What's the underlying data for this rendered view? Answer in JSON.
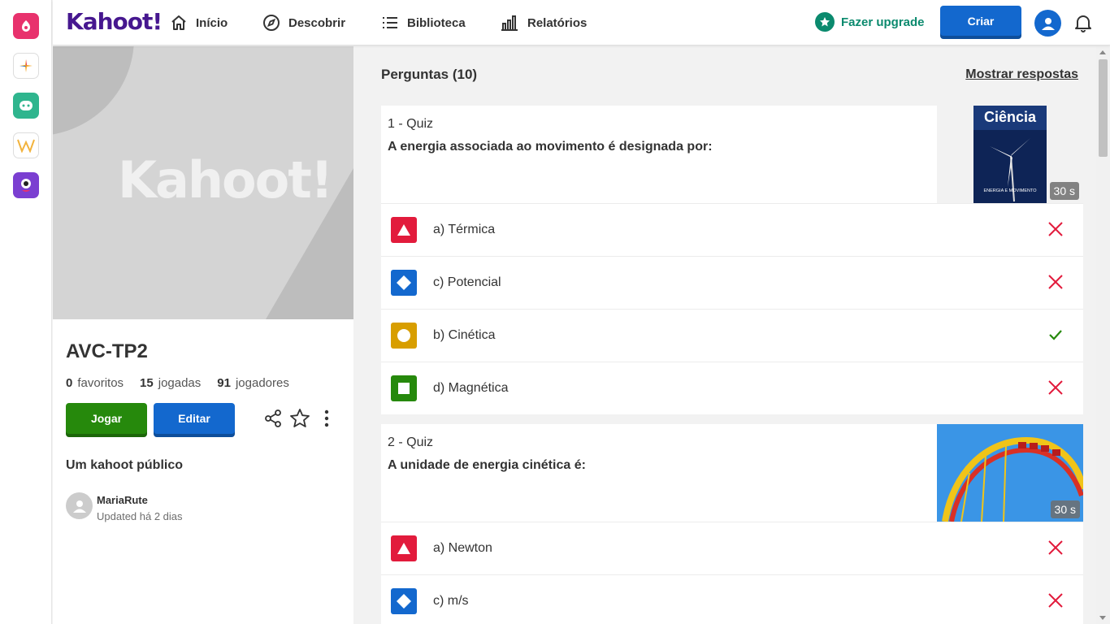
{
  "rail": {
    "apps": [
      {
        "icon": "app-icon-pink",
        "color": "#e8326d"
      },
      {
        "icon": "app-icon-star",
        "color": "#f5a623"
      },
      {
        "icon": "app-icon-chat",
        "color": "#2fb58e"
      },
      {
        "icon": "app-icon-w",
        "color": "#f2b33d"
      },
      {
        "icon": "app-icon-monster",
        "color": "#7b3fd1"
      }
    ]
  },
  "header": {
    "logo": "Kahoot!",
    "nav": [
      {
        "label": "Início",
        "icon": "home-icon"
      },
      {
        "label": "Descobrir",
        "icon": "compass-icon"
      },
      {
        "label": "Biblioteca",
        "icon": "list-icon"
      },
      {
        "label": "Relatórios",
        "icon": "bar-chart-icon"
      }
    ],
    "upgrade_label": "Fazer upgrade",
    "create_label": "Criar"
  },
  "kahoot": {
    "cover_word": "Kahoot!",
    "title": "AVC-TP2",
    "stats": {
      "favorites": "0",
      "favorites_label": "favoritos",
      "plays": "15",
      "plays_label": "jogadas",
      "players": "91",
      "players_label": "jogadores"
    },
    "play_label": "Jogar",
    "edit_label": "Editar",
    "visibility": "Um kahoot público",
    "author": "MariaRute",
    "updated": "Updated há 2 dias"
  },
  "questions": {
    "header": "Perguntas (10)",
    "show_answers": "Mostrar respostas",
    "items": [
      {
        "type": "1 - Quiz",
        "text": "A energia associada ao movimento é designada por:",
        "time": "30 s",
        "image_title": "Ciência",
        "image_caption": "ENERGIA E MOVIMENTO",
        "answers": [
          {
            "text": "a) Térmica",
            "shape": "triangle",
            "correct": false
          },
          {
            "text": "c) Potencial",
            "shape": "diamond",
            "correct": false
          },
          {
            "text": "b) Cinética",
            "shape": "circle",
            "correct": true
          },
          {
            "text": "d) Magnética",
            "shape": "square",
            "correct": false
          }
        ]
      },
      {
        "type": "2 - Quiz",
        "text": "A unidade de energia cinética é:",
        "time": "30 s",
        "answers": [
          {
            "text": "a) Newton",
            "shape": "triangle",
            "correct": false
          },
          {
            "text": "c) m/s",
            "shape": "diamond",
            "correct": false
          }
        ]
      }
    ]
  },
  "colors": {
    "triangle": "#e21b3c",
    "diamond": "#1368ce",
    "circle": "#d89e00",
    "square": "#26890c",
    "wrong": "#e21b3c",
    "correct": "#26890c",
    "brand": "#46178f"
  }
}
